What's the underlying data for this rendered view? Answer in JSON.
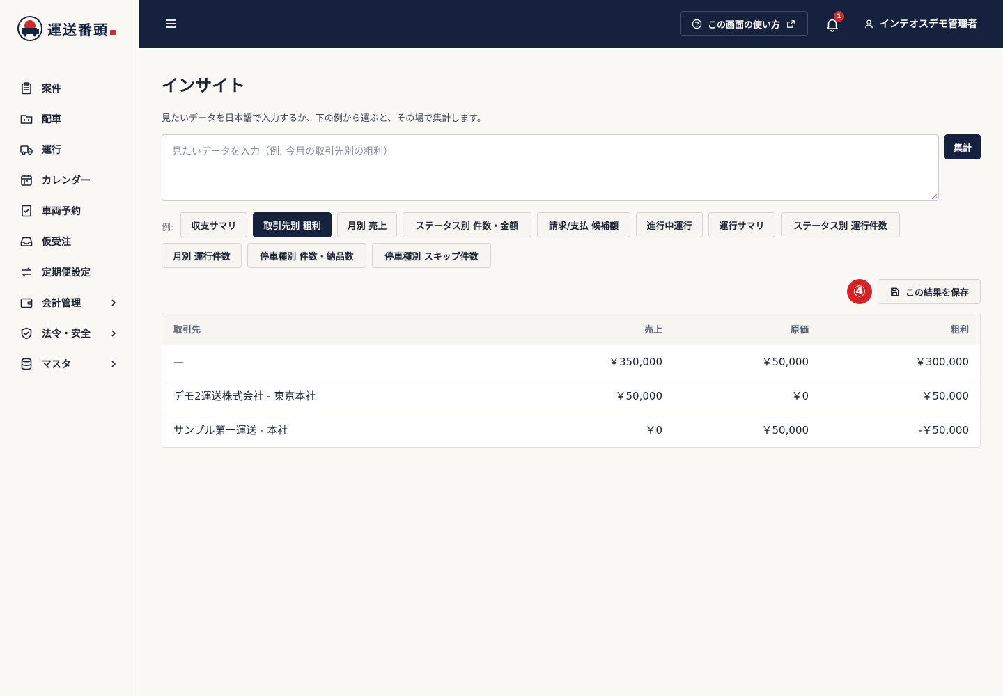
{
  "app": {
    "logo_text": "運送番頭"
  },
  "sidebar": {
    "items": [
      {
        "label": "案件",
        "icon": "clipboard-icon"
      },
      {
        "label": "配車",
        "icon": "calendar-folder-icon"
      },
      {
        "label": "運行",
        "icon": "truck-icon"
      },
      {
        "label": "カレンダー",
        "icon": "calendar-icon"
      },
      {
        "label": "車両予約",
        "icon": "clipboard-check-icon"
      },
      {
        "label": "仮受注",
        "icon": "inbox-icon"
      },
      {
        "label": "定期便設定",
        "icon": "repeat-icon"
      },
      {
        "label": "会計管理",
        "icon": "wallet-icon"
      },
      {
        "label": "法令・安全",
        "icon": "shield-check-icon"
      },
      {
        "label": "マスタ",
        "icon": "database-icon"
      }
    ]
  },
  "header": {
    "help_label": "この画面の使い方",
    "notification_count": "1",
    "user_name": "インテオスデモ管理者"
  },
  "main": {
    "title": "インサイト",
    "description": "見たいデータを日本語で入力するか、下の例から選ぶと、その場で集計します。",
    "query_placeholder": "見たいデータを入力（例: 今月の取引先別の粗利）",
    "query_value": "",
    "run_label": "集計",
    "examples_label": "例:",
    "examples": [
      "収支サマリ",
      "取引先別 粗利",
      "月別 売上",
      "ステータス別 件数・金額",
      "請求/支払 候補額",
      "進行中運行",
      "運行サマリ",
      "ステータス別 運行件数",
      "月別 運行件数",
      "停車種別 件数・納品数",
      "停車種別 スキップ件数"
    ],
    "active_example": "取引先別 粗利",
    "step_marker": "④",
    "save_label": "この結果を保存",
    "table": {
      "headers": [
        "取引先",
        "売上",
        "原価",
        "粗利"
      ],
      "rows": [
        [
          "—",
          "￥350,000",
          "￥50,000",
          "￥300,000"
        ],
        [
          "デモ2運送株式会社 - 東京本社",
          "￥50,000",
          "￥0",
          "￥50,000"
        ],
        [
          "サンプル第一運送 - 本社",
          "￥0",
          "￥50,000",
          "-￥50,000"
        ]
      ]
    }
  },
  "colors": {
    "navy": "#15213d",
    "badge_red": "#d42f2f",
    "background": "#f9f8f5"
  }
}
